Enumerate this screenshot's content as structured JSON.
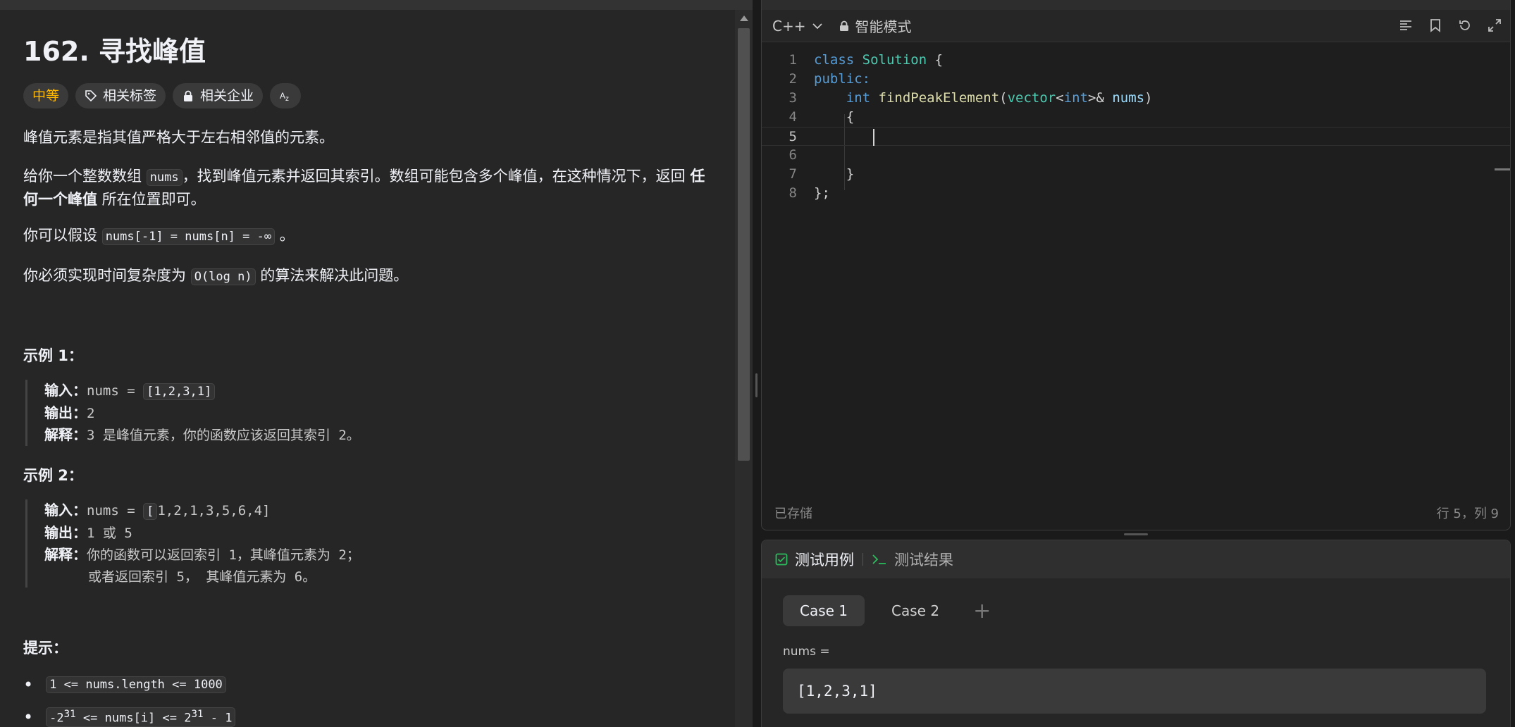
{
  "problem": {
    "title": "162. 寻找峰值",
    "difficulty": "中等",
    "tags": [
      "相关标签",
      "相关企业"
    ],
    "desc1": "峰值元素是指其值严格大于左右相邻值的元素。",
    "desc2_a": "给你一个整数数组 ",
    "desc2_code": "nums",
    "desc2_b": "，找到峰值元素并返回其索引。数组可能包含多个峰值，在这种情况下，返回 ",
    "desc2_bold": "任何一个峰值",
    "desc2_c": " 所在位置即可。",
    "desc3_a": "你可以假设 ",
    "desc3_code": "nums[-1] = nums[n] = -∞",
    "desc3_b": " 。",
    "desc4_a": "你必须实现时间复杂度为 ",
    "desc4_code": "O(log n)",
    "desc4_b": " 的算法来解决此问题。",
    "example1": {
      "heading": "示例 1：",
      "input_label": "输入：",
      "input_var": "nums = ",
      "input_val": "[1,2,3,1]",
      "output_label": "输出：",
      "output_val": "2",
      "explain_label": "解释：",
      "explain_val": "3 是峰值元素，你的函数应该返回其索引 2。"
    },
    "example2": {
      "heading": "示例 2：",
      "input_label": "输入：",
      "input_var": "nums = ",
      "input_bracket": "[",
      "input_val": "1,2,1,3,5,6,4]",
      "output_label": "输出：",
      "output_val": "1 或 5",
      "explain_label": "解释：",
      "explain_val1": "你的函数可以返回索引 1，其峰值元素为 2；",
      "explain_val2": "或者返回索引 5， 其峰值元素为 6。"
    },
    "hints_heading": "提示：",
    "hint1": "1 <= nums.length <= 1000",
    "hint2_a": "-2",
    "hint2_sup1": "31",
    "hint2_b": " <= nums[i] <= 2",
    "hint2_sup2": "31",
    "hint2_c": " - 1"
  },
  "editor": {
    "language": "C++",
    "mode": "智能模式",
    "saved": "已存储",
    "cursor_pos": "行 5，列 9",
    "lines": [
      "1",
      "2",
      "3",
      "4",
      "5",
      "6",
      "7",
      "8"
    ],
    "code": {
      "l1_kw": "class",
      "l1_ty": "Solution",
      "l1_rest": " {",
      "l2_kw": "public:",
      "l3_kw": "int",
      "l3_fn": "findPeakElement",
      "l3_p1": "(",
      "l3_ty1": "vector",
      "l3_p2": "<",
      "l3_kw2": "int",
      "l3_p3": ">& ",
      "l3_pm": "nums",
      "l3_p4": ")",
      "l4": "{",
      "l7": "}",
      "l8": "};"
    }
  },
  "tests": {
    "tab_cases": "测试用例",
    "tab_results": "测试结果",
    "cases": [
      "Case 1",
      "Case 2"
    ],
    "add": "+",
    "param_label": "nums =",
    "param_value": "[1,2,3,1]"
  }
}
